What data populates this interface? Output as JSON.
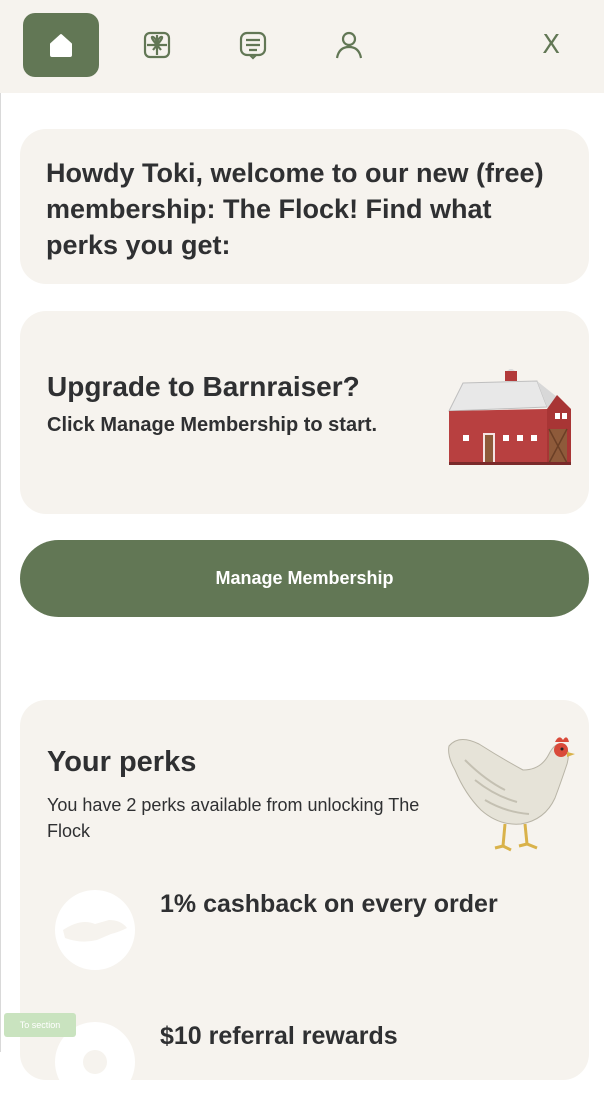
{
  "nav": {
    "items": [
      {
        "icon": "home-icon",
        "active": true
      },
      {
        "icon": "gift-icon",
        "active": false
      },
      {
        "icon": "message-icon",
        "active": false
      },
      {
        "icon": "user-icon",
        "active": false
      }
    ],
    "close_label": "X"
  },
  "welcome": {
    "text": "Howdy Toki, welcome to our new (free) membership: The Flock! Find what perks you get:"
  },
  "upgrade": {
    "title": "Upgrade to Barnraiser?",
    "subtitle": "Click Manage Membership to start.",
    "image_icon": "barn-illustration"
  },
  "manage_button": "Manage Membership",
  "perks": {
    "title": "Your perks",
    "subtitle": "You have 2 perks available from unlocking The Flock",
    "image_icon": "chicken-illustration",
    "items": [
      {
        "label": "1% cashback on every order",
        "icon": "cashback-icon"
      },
      {
        "label": "$10 referral rewards",
        "icon": "referral-icon"
      }
    ]
  },
  "to_section": "To section",
  "colors": {
    "brand": "#627755",
    "card": "#f6f3ee",
    "text": "#2f3032"
  }
}
